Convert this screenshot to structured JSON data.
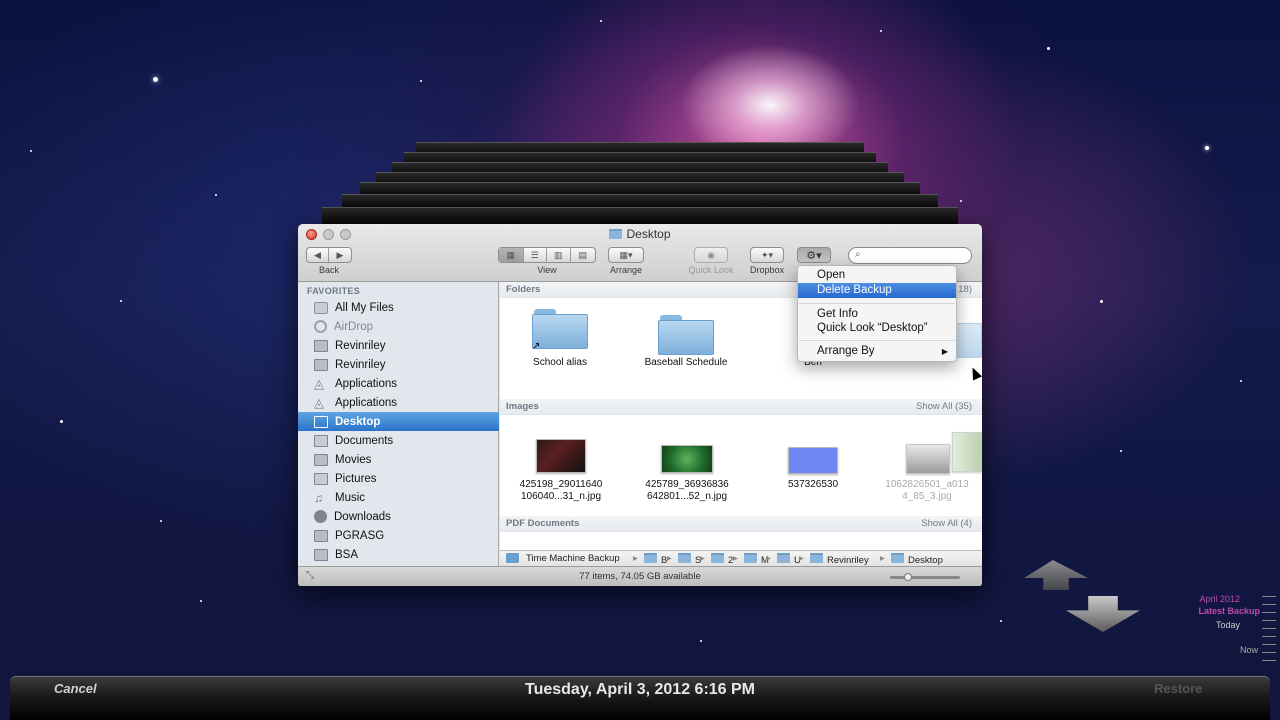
{
  "window": {
    "title": "Desktop",
    "toolbar": {
      "back_label": "Back",
      "view_label": "View",
      "arrange_label": "Arrange",
      "quicklook_label": "Quick Look",
      "dropbox_label": "Dropbox",
      "search_placeholder": ""
    }
  },
  "sidebar": {
    "header": "FAVORITES",
    "items": [
      {
        "label": "All My Files",
        "icon": "all-files-icon"
      },
      {
        "label": "AirDrop",
        "icon": "airdrop-icon"
      },
      {
        "label": "Revinriley",
        "icon": "folder-icon"
      },
      {
        "label": "Revinriley",
        "icon": "folder-icon"
      },
      {
        "label": "Applications",
        "icon": "applications-icon"
      },
      {
        "label": "Applications",
        "icon": "applications-icon"
      },
      {
        "label": "Desktop",
        "icon": "desktop-icon"
      },
      {
        "label": "Documents",
        "icon": "documents-icon"
      },
      {
        "label": "Movies",
        "icon": "movies-icon"
      },
      {
        "label": "Pictures",
        "icon": "pictures-icon"
      },
      {
        "label": "Music",
        "icon": "music-icon"
      },
      {
        "label": "Downloads",
        "icon": "downloads-icon"
      },
      {
        "label": "PGRASG",
        "icon": "folder-icon"
      },
      {
        "label": "BSA",
        "icon": "folder-icon"
      }
    ]
  },
  "sections": {
    "folders": {
      "title": "Folders",
      "count": "18)",
      "items": [
        {
          "name": "School alias"
        },
        {
          "name": "Baseball Schedule"
        },
        {
          "name": "Ben"
        }
      ]
    },
    "images": {
      "title": "Images",
      "show_all": "Show All (35)",
      "items": [
        {
          "line1": "425198_29011640",
          "line2": "106040...31_n.jpg"
        },
        {
          "line1": "425789_36936836",
          "line2": "642801...52_n.jpg"
        },
        {
          "line1": "537326530",
          "line2": ""
        },
        {
          "line1": "1062826501_a013",
          "line2": "4_85_3.jpg"
        }
      ]
    },
    "pdf": {
      "title": "PDF Documents",
      "show_all": "Show All (4)"
    }
  },
  "pathbar": {
    "root": "Time Machine Backup",
    "trunc": [
      "B",
      "S",
      "2",
      "M",
      "U"
    ],
    "user": "Revinriley",
    "current": "Desktop"
  },
  "status": "77 items, 74.05 GB available",
  "context_menu": {
    "items": [
      "Open",
      "Delete Backup",
      "Get Info",
      "Quick Look “Desktop”",
      "Arrange By"
    ],
    "submenu_arrow": "▶"
  },
  "bottom_bar": {
    "cancel": "Cancel",
    "date": "Tuesday, April 3, 2012 6:16 PM",
    "restore": "Restore"
  },
  "timeline": {
    "month": "April 2012",
    "latest": "Latest Backup",
    "today": "Today",
    "now": "Now"
  },
  "colors": {
    "selection": "#2a73c9",
    "menu_highlight": "#2867d0",
    "timeline_accent": "#c04aa6"
  }
}
